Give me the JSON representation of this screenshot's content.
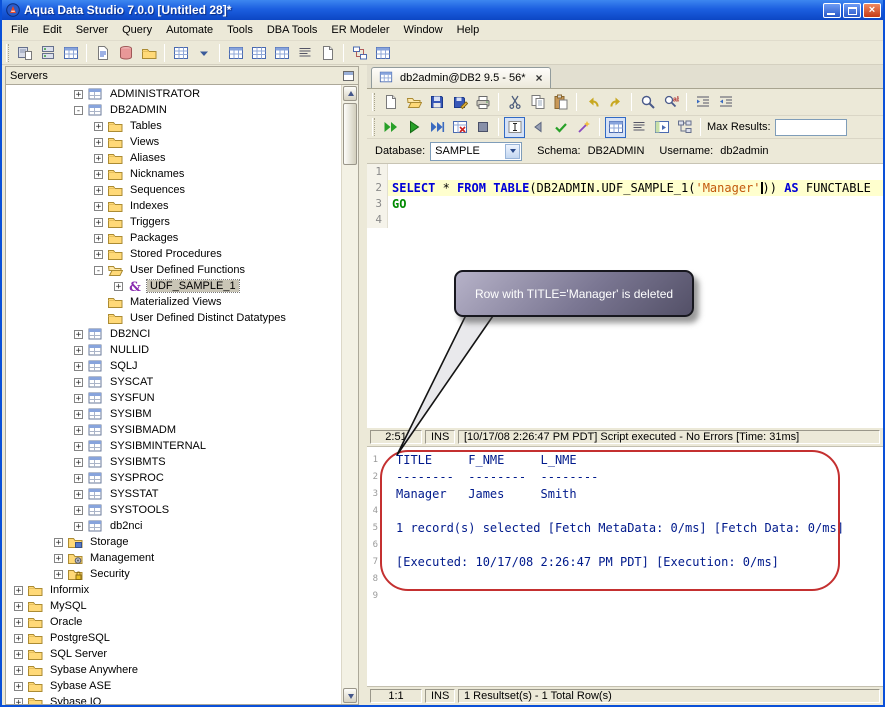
{
  "window": {
    "title": "Aqua Data Studio 7.0.0 [Untitled 28]*"
  },
  "menu": {
    "items": [
      "File",
      "Edit",
      "Server",
      "Query",
      "Automate",
      "Tools",
      "DBA Tools",
      "ER Modeler",
      "Window",
      "Help"
    ]
  },
  "main_toolbar": {
    "icons": [
      {
        "name": "register-server-icon",
        "icon": "serverPage"
      },
      {
        "name": "server-registrations-icon",
        "icon": "server"
      },
      {
        "name": "schema-browser-icon",
        "icon": "gridHead"
      },
      {
        "sep": true
      },
      {
        "name": "query-analyzer-icon",
        "icon": "sqlPage"
      },
      {
        "name": "instance-manager-icon",
        "icon": "db"
      },
      {
        "name": "storage-manager-icon",
        "icon": "folder"
      },
      {
        "sep": true
      },
      {
        "name": "session-manager-icon",
        "icon": "grid"
      },
      {
        "name": "window-selector-dropdown",
        "icon": "dropdown"
      },
      {
        "sep": true
      },
      {
        "name": "table-data-icon",
        "icon": "gridHead"
      },
      {
        "name": "row-count-icon",
        "icon": "grid"
      },
      {
        "name": "describe-table-icon",
        "icon": "gridHead"
      },
      {
        "name": "script-object-icon",
        "icon": "text"
      },
      {
        "name": "ddl-generator-icon",
        "icon": "page"
      },
      {
        "sep": true
      },
      {
        "name": "er-modeler-icon",
        "icon": "er"
      },
      {
        "name": "query-builder-icon",
        "icon": "gridHead"
      }
    ]
  },
  "servers_panel": {
    "title": "Servers",
    "tree": [
      {
        "label": "ADMINISTRATOR",
        "level": 3,
        "icon": "schema",
        "expand": "plus"
      },
      {
        "label": "DB2ADMIN",
        "level": 3,
        "icon": "schema",
        "expand": "minus"
      },
      {
        "label": "Tables",
        "level": 4,
        "icon": "folder",
        "expand": "plus"
      },
      {
        "label": "Views",
        "level": 4,
        "icon": "folder",
        "expand": "plus"
      },
      {
        "label": "Aliases",
        "level": 4,
        "icon": "folder",
        "expand": "plus"
      },
      {
        "label": "Nicknames",
        "level": 4,
        "icon": "folder",
        "expand": "plus"
      },
      {
        "label": "Sequences",
        "level": 4,
        "icon": "folder",
        "expand": "plus"
      },
      {
        "label": "Indexes",
        "level": 4,
        "icon": "folder",
        "expand": "plus"
      },
      {
        "label": "Triggers",
        "level": 4,
        "icon": "folder",
        "expand": "plus"
      },
      {
        "label": "Packages",
        "level": 4,
        "icon": "folder",
        "expand": "plus"
      },
      {
        "label": "Stored Procedures",
        "level": 4,
        "icon": "folder",
        "expand": "plus"
      },
      {
        "label": "User Defined Functions",
        "level": 4,
        "icon": "folderOpen",
        "expand": "minus"
      },
      {
        "label": "UDF_SAMPLE_1",
        "level": 5,
        "icon": "func",
        "expand": "plus",
        "selected": true
      },
      {
        "label": "Materialized Views",
        "level": 4,
        "icon": "folder",
        "expand": "none"
      },
      {
        "label": "User Defined Distinct Datatypes",
        "level": 4,
        "icon": "folder",
        "expand": "none"
      },
      {
        "label": "DB2NCI",
        "level": 3,
        "icon": "schema",
        "expand": "plus"
      },
      {
        "label": "NULLID",
        "level": 3,
        "icon": "schema",
        "expand": "plus"
      },
      {
        "label": "SQLJ",
        "level": 3,
        "icon": "schema",
        "expand": "plus"
      },
      {
        "label": "SYSCAT",
        "level": 3,
        "icon": "schema",
        "expand": "plus"
      },
      {
        "label": "SYSFUN",
        "level": 3,
        "icon": "schema",
        "expand": "plus"
      },
      {
        "label": "SYSIBM",
        "level": 3,
        "icon": "schema",
        "expand": "plus"
      },
      {
        "label": "SYSIBMADM",
        "level": 3,
        "icon": "schema",
        "expand": "plus"
      },
      {
        "label": "SYSIBMINTERNAL",
        "level": 3,
        "icon": "schema",
        "expand": "plus"
      },
      {
        "label": "SYSIBMTS",
        "level": 3,
        "icon": "schema",
        "expand": "plus"
      },
      {
        "label": "SYSPROC",
        "level": 3,
        "icon": "schema",
        "expand": "plus"
      },
      {
        "label": "SYSSTAT",
        "level": 3,
        "icon": "schema",
        "expand": "plus"
      },
      {
        "label": "SYSTOOLS",
        "level": 3,
        "icon": "schema",
        "expand": "plus"
      },
      {
        "label": "db2nci",
        "level": 3,
        "icon": "schema",
        "expand": "plus"
      },
      {
        "label": "Storage",
        "level": 2,
        "icon": "folderDisk",
        "expand": "plus"
      },
      {
        "label": "Management",
        "level": 2,
        "icon": "folderGear",
        "expand": "plus"
      },
      {
        "label": "Security",
        "level": 2,
        "icon": "folderLock",
        "expand": "plus"
      },
      {
        "label": "Informix",
        "level": 0,
        "icon": "folder",
        "expand": "plus"
      },
      {
        "label": "MySQL",
        "level": 0,
        "icon": "folder",
        "expand": "plus"
      },
      {
        "label": "Oracle",
        "level": 0,
        "icon": "folder",
        "expand": "plus"
      },
      {
        "label": "PostgreSQL",
        "level": 0,
        "icon": "folder",
        "expand": "plus"
      },
      {
        "label": "SQL Server",
        "level": 0,
        "icon": "folder",
        "expand": "plus"
      },
      {
        "label": "Sybase Anywhere",
        "level": 0,
        "icon": "folder",
        "expand": "plus"
      },
      {
        "label": "Sybase ASE",
        "level": 0,
        "icon": "folder",
        "expand": "plus"
      },
      {
        "label": "Sybase IQ",
        "level": 0,
        "icon": "folder",
        "expand": "plus"
      }
    ]
  },
  "tab": {
    "title": "db2admin@DB2 9.5 - 56*"
  },
  "editor_toolbar": {
    "icons": [
      {
        "name": "new-file-icon",
        "icon": "page"
      },
      {
        "name": "open-file-icon",
        "icon": "folderOpen"
      },
      {
        "name": "save-icon",
        "icon": "disk"
      },
      {
        "name": "save-as-icon",
        "icon": "diskPen"
      },
      {
        "name": "print-icon",
        "icon": "printer"
      },
      {
        "sep": true
      },
      {
        "name": "cut-icon",
        "icon": "cut"
      },
      {
        "name": "copy-icon",
        "icon": "copy"
      },
      {
        "name": "paste-icon",
        "icon": "paste"
      },
      {
        "sep": true
      },
      {
        "name": "undo-icon",
        "icon": "undo"
      },
      {
        "name": "redo-icon",
        "icon": "redo"
      },
      {
        "sep": true
      },
      {
        "name": "find-icon",
        "icon": "find"
      },
      {
        "name": "find-replace-icon",
        "icon": "findReplace"
      },
      {
        "sep": true
      },
      {
        "name": "indent-icon",
        "icon": "indent"
      },
      {
        "name": "outdent-icon",
        "icon": "outdent"
      }
    ]
  },
  "exec_toolbar": {
    "icons": [
      {
        "name": "execute-multiple-icon",
        "icon": "playAll"
      },
      {
        "name": "execute-icon",
        "icon": "play"
      },
      {
        "name": "execute-script-icon",
        "icon": "playScript"
      },
      {
        "name": "execute-edit-icon",
        "icon": "gridX"
      },
      {
        "name": "stop-icon",
        "icon": "stop"
      },
      {
        "sep": true
      },
      {
        "name": "current-statement-toggle",
        "icon": "cursorBox",
        "pressed": true
      },
      {
        "name": "previous-result-icon",
        "icon": "back"
      },
      {
        "name": "commit-icon",
        "icon": "commit"
      },
      {
        "name": "format-sql-icon",
        "icon": "wand"
      },
      {
        "sep": true
      },
      {
        "name": "results-grid-toggle",
        "icon": "gridHead",
        "pressed": true
      },
      {
        "name": "results-text-icon",
        "icon": "text"
      },
      {
        "name": "results-pivot-icon",
        "icon": "pivot"
      },
      {
        "name": "explain-plan-icon",
        "icon": "tree"
      },
      {
        "sep": true
      }
    ],
    "max_results_label": "Max Results:",
    "max_results_value": ""
  },
  "context_bar": {
    "database_label": "Database:",
    "database_value": "SAMPLE",
    "schema_label": "Schema:",
    "schema_value": "DB2ADMIN",
    "username_label": "Username:",
    "username_value": "db2admin"
  },
  "editor": {
    "lines": [
      {
        "no": 1,
        "tokens": []
      },
      {
        "no": 2,
        "current": true,
        "tokens": [
          {
            "t": "SELECT",
            "s": "kw"
          },
          {
            "t": " * ",
            "s": "pl"
          },
          {
            "t": "FROM",
            "s": "kw"
          },
          {
            "t": " ",
            "s": "pl"
          },
          {
            "t": "TABLE",
            "s": "kw"
          },
          {
            "t": "(DB2ADMIN.UDF_SAMPLE_1(",
            "s": "pl"
          },
          {
            "t": "'Manager'",
            "s": "str"
          },
          {
            "caret": true
          },
          {
            "t": ")) ",
            "s": "pl"
          },
          {
            "t": "AS",
            "s": "kw"
          },
          {
            "t": " FUNCTABLE",
            "s": "pl"
          }
        ]
      },
      {
        "no": 3,
        "tokens": [
          {
            "t": "GO",
            "s": "go"
          }
        ]
      },
      {
        "no": 4,
        "tokens": []
      }
    ]
  },
  "editor_status": {
    "position": "2:51",
    "mode": "INS",
    "message": "[10/17/08 2:26:47 PM PDT] Script executed - No Errors [Time: 31ms]"
  },
  "results": {
    "lines": [
      "TITLE     F_NME     L_NME",
      "--------  --------  --------",
      "Manager   James     Smith",
      "",
      "1 record(s) selected [Fetch MetaData: 0/ms] [Fetch Data: 0/ms]",
      "",
      "[Executed: 10/17/08 2:26:47 PM PDT] [Execution: 0/ms]",
      "",
      ""
    ]
  },
  "results_status": {
    "position": "1:1",
    "mode": "INS",
    "message": "1 Resultset(s) - 1 Total Row(s)"
  },
  "callout": {
    "text": "Row with TITLE='Manager' is deleted"
  }
}
